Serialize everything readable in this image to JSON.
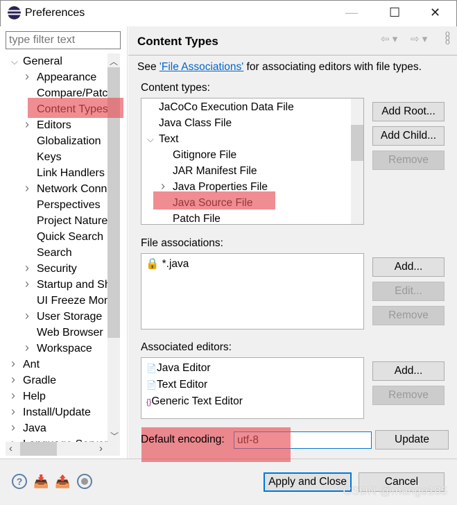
{
  "window": {
    "title": "Preferences",
    "minimize": "—",
    "maximize": "☐",
    "close": "✕"
  },
  "filter": {
    "placeholder": "type filter text"
  },
  "tree": [
    {
      "label": "General",
      "level": 0,
      "arrow": "v"
    },
    {
      "label": "Appearance",
      "level": 1,
      "arrow": ">"
    },
    {
      "label": "Compare/Patch",
      "level": 1,
      "arrow": ""
    },
    {
      "label": "Content Types",
      "level": 1,
      "arrow": "",
      "selected": true
    },
    {
      "label": "Editors",
      "level": 1,
      "arrow": ">"
    },
    {
      "label": "Globalization",
      "level": 1,
      "arrow": ""
    },
    {
      "label": "Keys",
      "level": 1,
      "arrow": ""
    },
    {
      "label": "Link Handlers",
      "level": 1,
      "arrow": ""
    },
    {
      "label": "Network Connections",
      "level": 1,
      "arrow": ">"
    },
    {
      "label": "Perspectives",
      "level": 1,
      "arrow": ""
    },
    {
      "label": "Project Natures",
      "level": 1,
      "arrow": ""
    },
    {
      "label": "Quick Search",
      "level": 1,
      "arrow": ""
    },
    {
      "label": "Search",
      "level": 1,
      "arrow": ""
    },
    {
      "label": "Security",
      "level": 1,
      "arrow": ">"
    },
    {
      "label": "Startup and Shutdown",
      "level": 1,
      "arrow": ">"
    },
    {
      "label": "UI Freeze Monitoring",
      "level": 1,
      "arrow": ""
    },
    {
      "label": "User Storage",
      "level": 1,
      "arrow": ">"
    },
    {
      "label": "Web Browser",
      "level": 1,
      "arrow": ""
    },
    {
      "label": "Workspace",
      "level": 1,
      "arrow": ">"
    },
    {
      "label": "Ant",
      "level": 0,
      "arrow": ">"
    },
    {
      "label": "Gradle",
      "level": 0,
      "arrow": ">"
    },
    {
      "label": "Help",
      "level": 0,
      "arrow": ">"
    },
    {
      "label": "Install/Update",
      "level": 0,
      "arrow": ">"
    },
    {
      "label": "Java",
      "level": 0,
      "arrow": ">"
    },
    {
      "label": "Language Servers",
      "level": 0,
      "arrow": ">"
    }
  ],
  "page": {
    "title": "Content Types",
    "intro_before": "See ",
    "intro_link": "'File Associations'",
    "intro_after": " for associating editors with file types."
  },
  "content_types": {
    "label": "Content types:",
    "items": [
      {
        "label": "JaCoCo Execution Data File",
        "level": 0,
        "arrow": ""
      },
      {
        "label": "Java Class File",
        "level": 0,
        "arrow": ""
      },
      {
        "label": "Text",
        "level": 0,
        "arrow": "v"
      },
      {
        "label": "Gitignore File",
        "level": 1,
        "arrow": ""
      },
      {
        "label": "JAR Manifest File",
        "level": 1,
        "arrow": ""
      },
      {
        "label": "Java Properties File",
        "level": 1,
        "arrow": ">"
      },
      {
        "label": "Java Source File",
        "level": 1,
        "arrow": "",
        "selected": true
      },
      {
        "label": "Patch File",
        "level": 1,
        "arrow": ""
      }
    ],
    "buttons": {
      "add_root": "Add Root...",
      "add_child": "Add Child...",
      "remove": "Remove"
    }
  },
  "file_associations": {
    "label": "File associations:",
    "items": [
      "*.java"
    ],
    "buttons": {
      "add": "Add...",
      "edit": "Edit...",
      "remove": "Remove"
    }
  },
  "associated_editors": {
    "label": "Associated editors:",
    "items": [
      "Java Editor",
      "Text Editor",
      "Generic Text Editor"
    ],
    "buttons": {
      "add": "Add...",
      "remove": "Remove"
    }
  },
  "encoding": {
    "label": "Default encoding:",
    "value": "utf-8",
    "update": "Update"
  },
  "footer": {
    "apply_close": "Apply and Close",
    "cancel": "Cancel"
  },
  "watermark": "CSDN @mango185",
  "colors": {
    "highlight": "#e85058",
    "link": "#0066cc",
    "focus": "#0078d7"
  }
}
